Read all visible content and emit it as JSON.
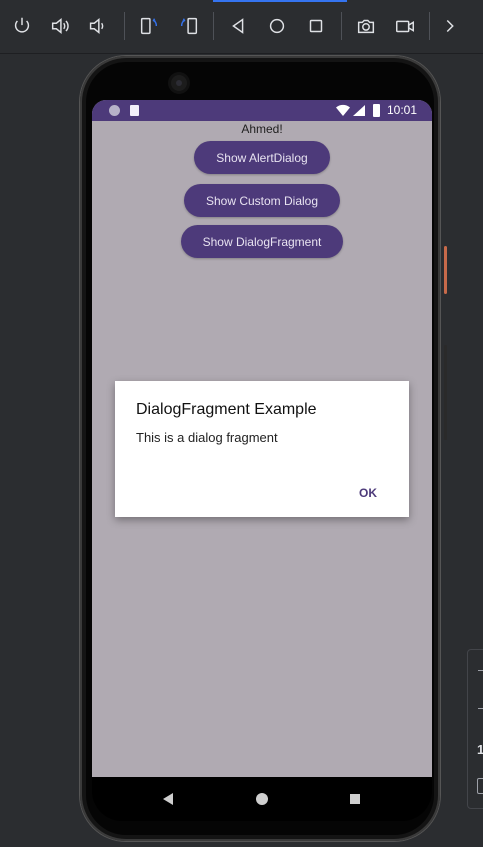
{
  "toolbar": {
    "buttons": [
      "power-icon",
      "volume-up-icon",
      "volume-down-icon",
      "rotate-left-icon",
      "rotate-right-icon",
      "back-icon",
      "home-icon",
      "overview-icon",
      "camera-icon",
      "screen-record-icon",
      "chevron-right-icon"
    ]
  },
  "status_bar": {
    "time": "10:01"
  },
  "app": {
    "greeting": "Ahmed!",
    "buttons": {
      "alert": "Show AlertDialog",
      "custom": "Show Custom Dialog",
      "fragment": "Show DialogFragment"
    }
  },
  "dialog": {
    "title": "DialogFragment Example",
    "message": "This is a dialog fragment",
    "ok": "OK"
  },
  "side_panel": {
    "value": "1"
  },
  "colors": {
    "primary": "#4d3a7a",
    "scrim": "#b0aab2",
    "dialog": "#ffffff"
  }
}
